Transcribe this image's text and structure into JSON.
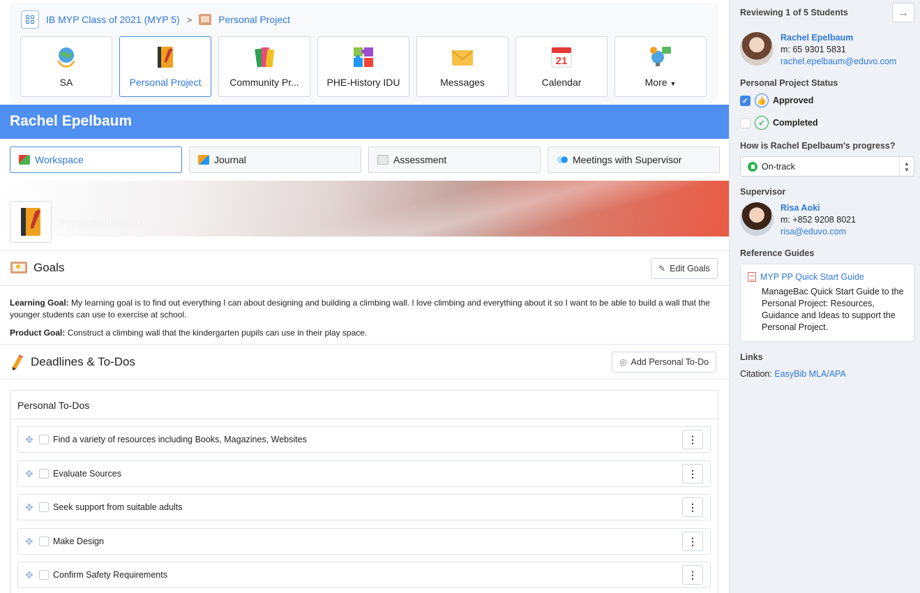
{
  "breadcrumb": {
    "class_name": "IB MYP Class of 2021 (MYP 5)",
    "separator": ">",
    "current": "Personal Project"
  },
  "tiles": [
    {
      "label": "SA",
      "icon": "globe-hands-icon",
      "active": false
    },
    {
      "label": "Personal Project",
      "icon": "notebook-icon",
      "active": true
    },
    {
      "label": "Community Pr...",
      "icon": "books-icon",
      "active": false
    },
    {
      "label": "PHE-History IDU",
      "icon": "puzzle-icon",
      "active": false
    },
    {
      "label": "Messages",
      "icon": "envelope-icon",
      "active": false
    },
    {
      "label": "Calendar",
      "icon": "calendar-icon",
      "active": false,
      "day": "21"
    },
    {
      "label": "More",
      "icon": "lightbulb-chat-icon",
      "active": false
    }
  ],
  "student_name": "Rachel Epelbaum",
  "subtabs": [
    {
      "label": "Workspace",
      "active": true
    },
    {
      "label": "Journal",
      "active": false
    },
    {
      "label": "Assessment",
      "active": false
    },
    {
      "label": "Meetings with Supervisor",
      "active": false
    }
  ],
  "hero": {
    "title": "Personal Project"
  },
  "goals": {
    "heading": "Goals",
    "edit_button": "Edit Goals",
    "learning_label": "Learning Goal:",
    "learning_text": "My learning goal is to find out everything I can about designing and building a climbing wall. I love climbing and everything about it so I want to be able to build a wall that the younger students can use to exercise at school.",
    "product_label": "Product Goal:",
    "product_text": "Construct a climbing wall that the kindergarten pupils can use in their play space."
  },
  "deadlines": {
    "heading": "Deadlines & To-Dos",
    "add_button": "Add Personal To-Do",
    "box_title": "Personal To-Dos",
    "items": [
      "Find a variety of resources including Books, Magazines, Websites",
      "Evaluate Sources",
      "Seek support from suitable adults",
      "Make Design",
      "Confirm Safety Requirements"
    ]
  },
  "sidebar": {
    "reviewing": "Reviewing 1 of 5 Students",
    "student": {
      "name": "Rachel Epelbaum",
      "mobile": "m: 65 9301 5831",
      "email": "rachel.epelbaum@eduvo.com"
    },
    "status_label": "Personal Project Status",
    "approved_label": "Approved",
    "approved_checked": true,
    "completed_label": "Completed",
    "completed_checked": false,
    "progress_label": "How is Rachel Epelbaum's progress?",
    "progress_value": "On-track",
    "supervisor_label": "Supervisor",
    "supervisor": {
      "name": "Risa Aoki",
      "mobile": "m: +852 9208 8021",
      "email": "risa@eduvo.com"
    },
    "guides_label": "Reference Guides",
    "guide_title": "MYP PP Quick Start Guide",
    "guide_desc": "ManageBac Quick Start Guide to the Personal Project: Resources, Guidance and Ideas to support the Personal Project.",
    "links_label": "Links",
    "citation_prefix": "Citation:",
    "citation_link": "EasyBib MLA/APA"
  },
  "colors": {
    "accent": "#4f8ff0",
    "link": "#2f78d8",
    "sidebar_bg": "#eef1f5",
    "on_track": "#2bb24c"
  }
}
